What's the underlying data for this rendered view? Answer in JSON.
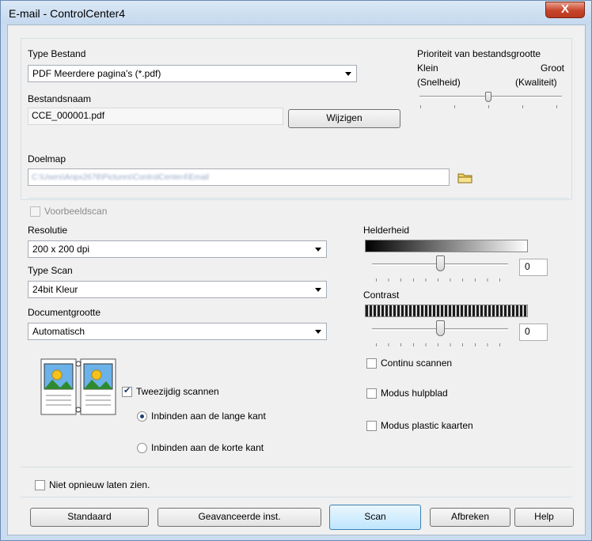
{
  "window": {
    "title": "E-mail - ControlCenter4",
    "close_glyph": "X"
  },
  "file_type": {
    "label": "Type Bestand",
    "value": "PDF Meerdere pagina's (*.pdf)"
  },
  "file_name": {
    "label": "Bestandsnaam",
    "value": "CCE_000001.pdf",
    "change_button": "Wijzigen"
  },
  "priority": {
    "label": "Prioriteit van bestandsgrootte",
    "small": "Klein",
    "large": "Groot",
    "small_sub": "(Snelheid)",
    "large_sub": "(Kwaliteit)",
    "level": 0.5
  },
  "destination": {
    "label": "Doelmap",
    "value": "C:\\Users\\Anpx2678\\Pictures\\ControlCenter4\\Email",
    "folder_icon": "folder-icon"
  },
  "preview_scan": {
    "label": "Voorbeeldscan",
    "checked": false,
    "enabled": false
  },
  "resolution": {
    "label": "Resolutie",
    "value": "200 x 200 dpi"
  },
  "scan_type": {
    "label": "Type Scan",
    "value": "24bit Kleur"
  },
  "document_size": {
    "label": "Documentgrootte",
    "value": "Automatisch"
  },
  "brightness": {
    "label": "Helderheid",
    "value": "0"
  },
  "contrast": {
    "label": "Contrast",
    "value": "0"
  },
  "duplex": {
    "label": "Tweezijdig scannen",
    "checked": true,
    "long_edge": "Inbinden aan de lange kant",
    "short_edge": "Inbinden aan de korte kant",
    "selected": "long_edge"
  },
  "continuous_scan": {
    "label": "Continu scannen",
    "checked": false
  },
  "carrier_sheet": {
    "label": "Modus hulpblad",
    "checked": false
  },
  "plastic_card": {
    "label": "Modus plastic kaarten",
    "checked": false
  },
  "dont_show_again": {
    "label": "Niet opnieuw laten zien.",
    "checked": false
  },
  "buttons": {
    "default": "Standaard",
    "advanced": "Geavanceerde inst.",
    "scan": "Scan",
    "cancel": "Afbreken",
    "help": "Help"
  },
  "colors": {
    "titlebar": "#c4d8ee",
    "close": "#c8442a",
    "focus_button": "#bee6fd"
  }
}
